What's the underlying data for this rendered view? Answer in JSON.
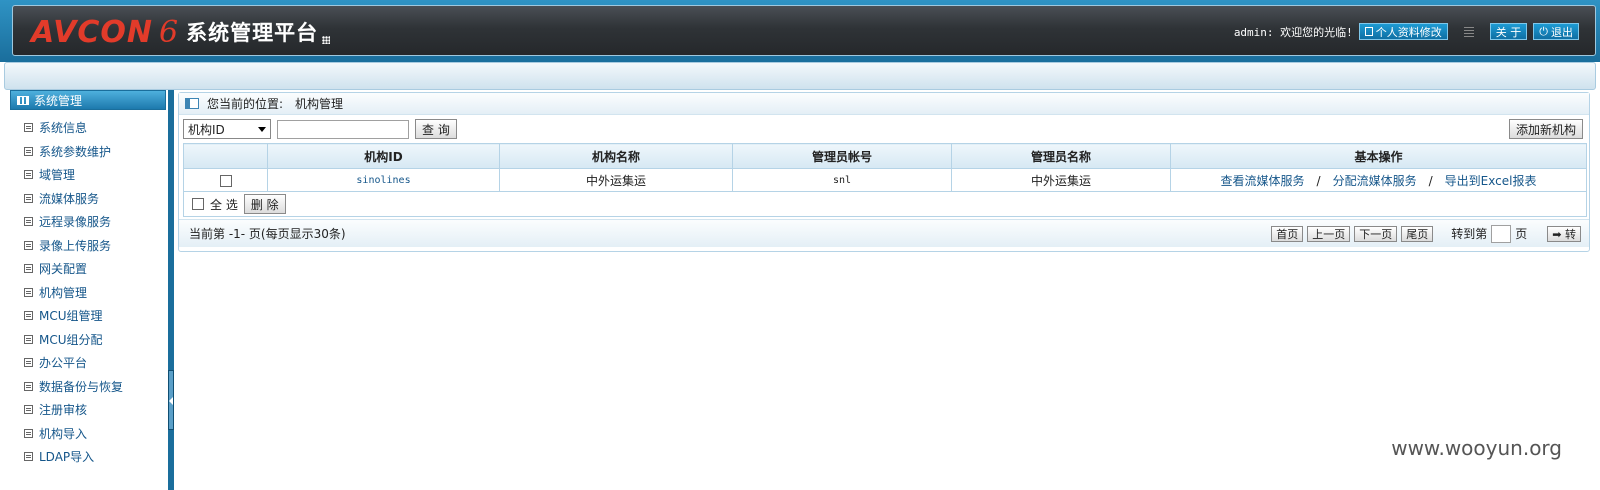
{
  "header": {
    "brand": "AVCON",
    "version": "6",
    "title": "系统管理平台",
    "welcome": "admin: 欢迎您的光临!",
    "profile_button": "个人资料修改",
    "about_button": "关 于",
    "logout_button": "退出"
  },
  "sidebar": {
    "title": "系统管理",
    "items": [
      {
        "label": "系统信息"
      },
      {
        "label": "系统参数维护"
      },
      {
        "label": "域管理"
      },
      {
        "label": "流媒体服务"
      },
      {
        "label": "远程录像服务"
      },
      {
        "label": "录像上传服务"
      },
      {
        "label": "网关配置"
      },
      {
        "label": "机构管理"
      },
      {
        "label": "MCU组管理"
      },
      {
        "label": "MCU组分配"
      },
      {
        "label": "办公平台"
      },
      {
        "label": "数据备份与恢复"
      },
      {
        "label": "注册审核"
      },
      {
        "label": "机构导入"
      },
      {
        "label": "LDAP导入"
      }
    ]
  },
  "main": {
    "breadcrumb_label": "您当前的位置:",
    "breadcrumb_value": "机构管理",
    "filter_select": "机构ID",
    "search_value": "",
    "query_button": "查 询",
    "add_button": "添加新机构",
    "columns": [
      "",
      "机构ID",
      "机构名称",
      "管理员帐号",
      "管理员名称",
      "基本操作"
    ],
    "rows": [
      {
        "id": "sinolines",
        "name": "中外运集运",
        "admin_account": "snl",
        "admin_name": "中外运集运",
        "ops": [
          "查看流媒体服务",
          "分配流媒体服务",
          "导出到Excel报表"
        ]
      }
    ],
    "op_separator": "/",
    "select_all_label": "全 选",
    "delete_button": "删 除",
    "pager": {
      "info": "当前第 -1- 页(每页显示30条)",
      "first": "首页",
      "prev": "上一页",
      "next": "下一页",
      "last": "尾页",
      "goto_label": "转到第",
      "page_unit": "页",
      "go_button": "➡ 转"
    }
  },
  "watermark": "www.wooyun.org"
}
